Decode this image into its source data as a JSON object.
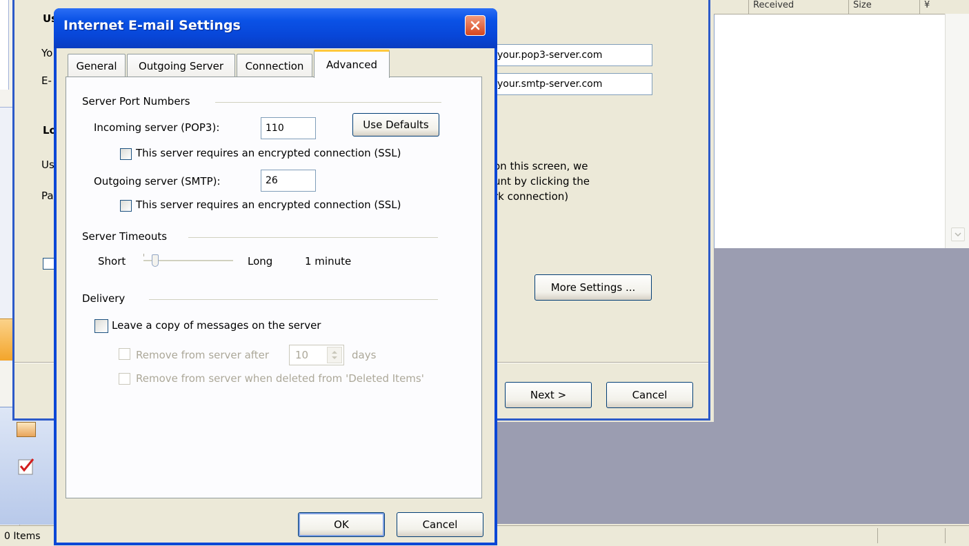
{
  "background_window": {
    "fragments": [
      "Us",
      "Yo",
      "E-",
      "Lo",
      "Us",
      "Pa"
    ],
    "incoming_server_value": "your.pop3-server.com",
    "outgoing_server_value": "your.smtp-server.com",
    "info_text_lines": [
      "on this screen, we",
      "unt by clicking the",
      "rk connection)"
    ],
    "more_settings_label": "More Settings ...",
    "next_label": "Next >",
    "cancel_label": "Cancel"
  },
  "mail_list": {
    "columns": [
      "Received",
      "Size",
      "¥"
    ]
  },
  "status_bar": {
    "items_text": "0 Items"
  },
  "dialog": {
    "title": "Internet E-mail Settings",
    "tabs": [
      "General",
      "Outgoing Server",
      "Connection",
      "Advanced"
    ],
    "active_tab": "Advanced",
    "server_ports": {
      "group_title": "Server Port Numbers",
      "incoming_label": "Incoming server (POP3):",
      "incoming_value": "110",
      "use_defaults_label": "Use Defaults",
      "incoming_ssl_label": "This server requires an encrypted connection (SSL)",
      "outgoing_label": "Outgoing server (SMTP):",
      "outgoing_value": "26",
      "outgoing_ssl_label": "This server requires an encrypted connection (SSL)"
    },
    "timeouts": {
      "group_title": "Server Timeouts",
      "short_label": "Short",
      "long_label": "Long",
      "value_text": "1 minute",
      "slider_level": 0.1
    },
    "delivery": {
      "group_title": "Delivery",
      "leave_copy_label": "Leave a copy of messages on the server",
      "remove_after_label": "Remove from server after",
      "remove_after_value": "10",
      "days_label": "days",
      "remove_deleted_label": "Remove from server when deleted from 'Deleted Items'"
    },
    "ok_label": "OK",
    "cancel_label": "Cancel"
  },
  "colors": {
    "titlebar": "#0a52e6",
    "close_button": "#d6451e",
    "active_tab_accent": "#ffc83c",
    "dialog_face": "#ece9d8",
    "reading_pane": "#9b9db1"
  }
}
